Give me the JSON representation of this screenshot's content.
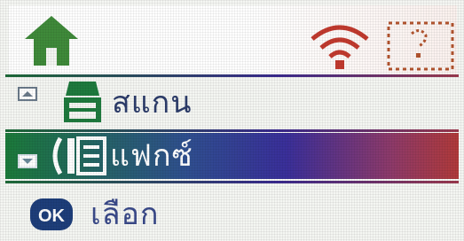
{
  "menu": {
    "items": [
      {
        "label": "สแกน",
        "icon": "scanner-icon"
      },
      {
        "label": "แฟกซ์",
        "icon": "fax-icon",
        "selected": true
      }
    ]
  },
  "footer": {
    "ok_key": "OK",
    "select_label": "เลือก"
  },
  "colors": {
    "home": "#3f8a3a",
    "wifi": "#c23a2e",
    "highlight_start": "#1b7a3a",
    "highlight_mid": "#3a2f9a",
    "highlight_end": "#b03a3a",
    "text": "#2c3c6a"
  }
}
